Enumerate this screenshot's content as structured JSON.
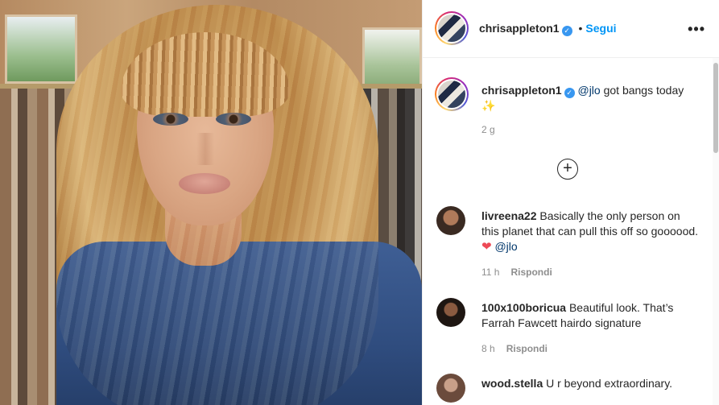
{
  "post": {
    "author": "chrisappleton1",
    "verified_mark": "✓",
    "separator": "•",
    "follow_label": "Segui",
    "more_label": "•••"
  },
  "caption": {
    "author": "chrisappleton1",
    "mention": "@jlo",
    "text": "got bangs today",
    "emoji": "✨",
    "time": "2 g"
  },
  "load_more_label": "+",
  "comments": [
    {
      "author": "livreena22",
      "text": "Basically the only person on this planet that can pull this off so goooood.",
      "heart": "❤",
      "mention": "@jlo",
      "time": "11 h",
      "reply_label": "Rispondi"
    },
    {
      "author": "100x100boricua",
      "text": "Beautiful look. That’s Farrah Fawcett hairdo signature",
      "time": "8 h",
      "reply_label": "Rispondi"
    },
    {
      "author": "wood.stella",
      "text": "U r beyond extraordinary."
    }
  ],
  "colors": {
    "accent": "#0095f6",
    "verified": "#3897f0",
    "heart": "#ed4956",
    "muted": "#8e8e8e"
  }
}
